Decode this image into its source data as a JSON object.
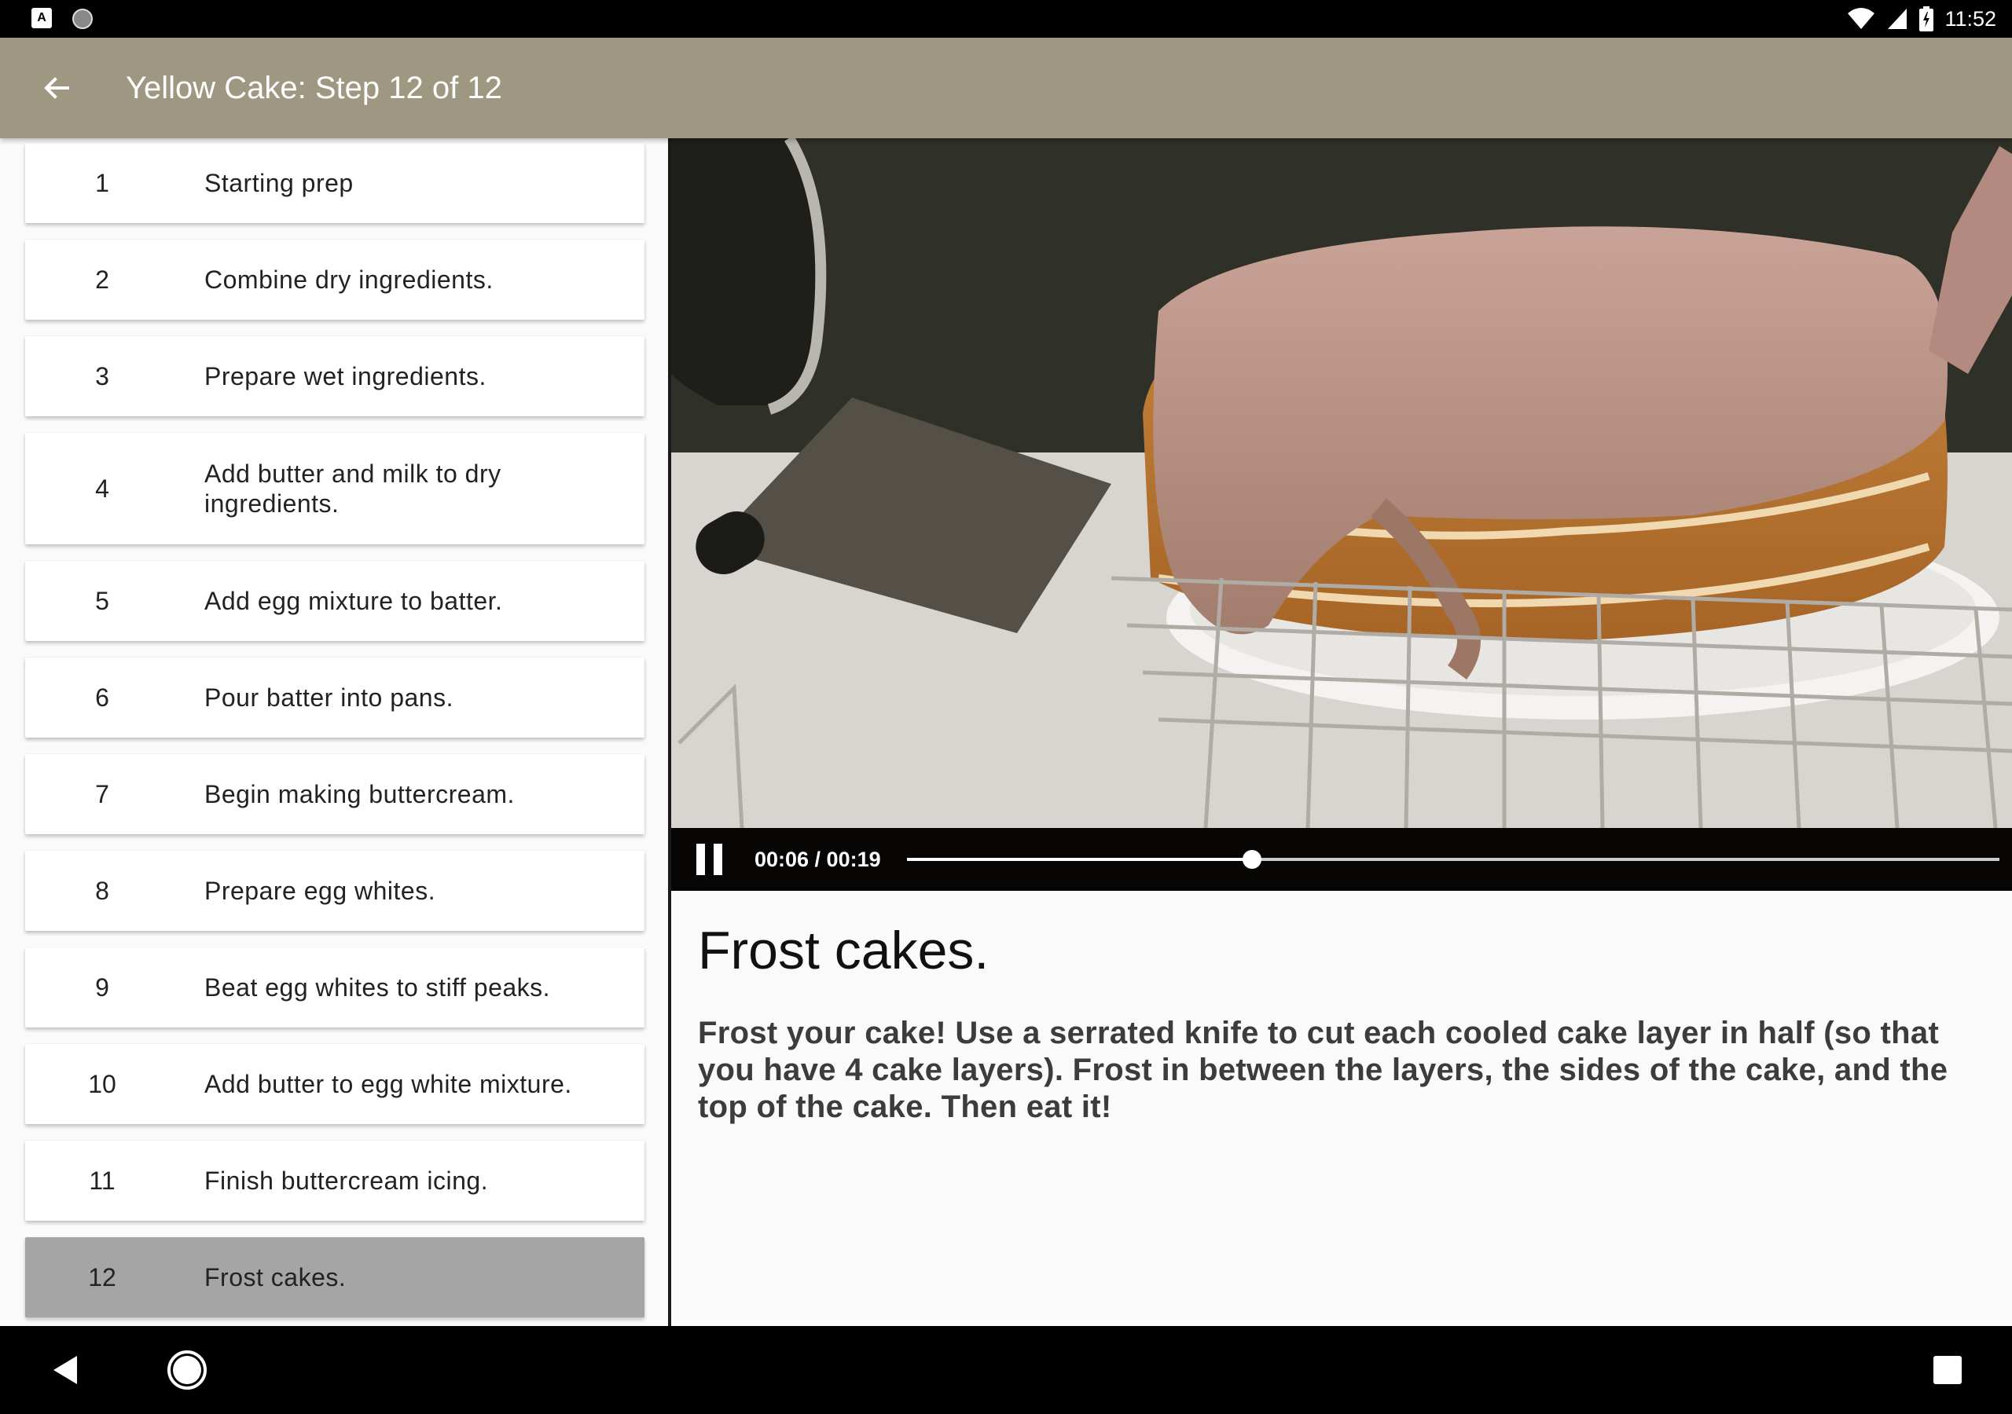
{
  "status_bar": {
    "time": "11:52",
    "left_icons": [
      "a-notification-icon",
      "circle-notification-icon"
    ],
    "right_icons": [
      "wifi-icon",
      "signal-icon",
      "battery-icon"
    ]
  },
  "app_bar": {
    "back_icon": "arrow-left-icon",
    "title": "Yellow Cake: Step 12 of 12",
    "background": "#9e9781"
  },
  "steps": [
    {
      "number": "1",
      "description": "Starting prep"
    },
    {
      "number": "2",
      "description": "Combine dry ingredients."
    },
    {
      "number": "3",
      "description": "Prepare wet ingredients."
    },
    {
      "number": "4",
      "description": "Add butter and milk to dry ingredients."
    },
    {
      "number": "5",
      "description": "Add egg mixture to batter."
    },
    {
      "number": "6",
      "description": "Pour batter into pans."
    },
    {
      "number": "7",
      "description": "Begin making buttercream."
    },
    {
      "number": "8",
      "description": "Prepare egg whites."
    },
    {
      "number": "9",
      "description": "Beat egg whites to stiff peaks."
    },
    {
      "number": "10",
      "description": "Add butter to egg white mixture."
    },
    {
      "number": "11",
      "description": "Finish buttercream icing."
    },
    {
      "number": "12",
      "description": "Frost cakes."
    }
  ],
  "selected_step": "12",
  "video": {
    "time_display": "00:06 / 00:19",
    "progress": 0.316,
    "state_icon": "pause-icon"
  },
  "detail": {
    "title": "Frost cakes.",
    "text": "Frost your cake! Use a serrated knife to cut each cooled cake layer in half (so that you have 4 cake layers). Frost in between the layers, the sides of the cake, and the top of the cake. Then eat it!"
  },
  "nav_bar": {
    "icons": [
      "nav-back-icon",
      "nav-home-icon",
      "nav-recents-icon"
    ]
  }
}
